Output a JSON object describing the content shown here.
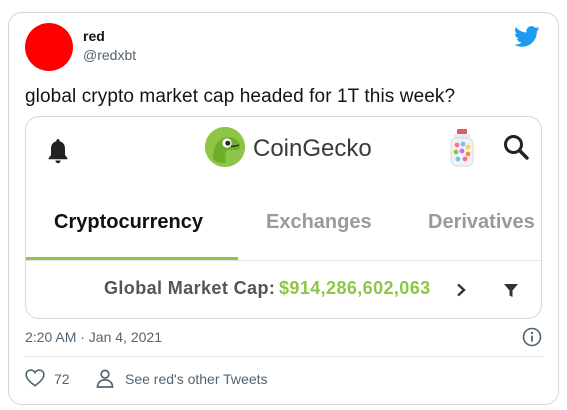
{
  "tweet": {
    "author_name": "red",
    "author_handle": "@redxbt",
    "text": "global crypto market cap headed for 1T this week?",
    "timestamp": "2:20 AM · Jan 4, 2021",
    "likes": "72",
    "other_tweets_link": "See red's other Tweets",
    "avatar_color": "#ff0000",
    "brand_color": "#1d9bf0"
  },
  "card": {
    "brand_name": "CoinGecko",
    "tabs": [
      {
        "label": "Cryptocurrency",
        "active": true
      },
      {
        "label": "Exchanges",
        "active": false
      },
      {
        "label": "Derivatives",
        "active": false
      }
    ],
    "global_market_cap_label": "Global Market Cap:",
    "global_market_cap_value": "$914,286,602,063",
    "accent_color": "#8dc647",
    "icons": [
      "bell-icon",
      "coingecko-logo-icon",
      "candy-jar-icon",
      "search-icon",
      "chevron-right-icon",
      "filter-icon"
    ]
  }
}
